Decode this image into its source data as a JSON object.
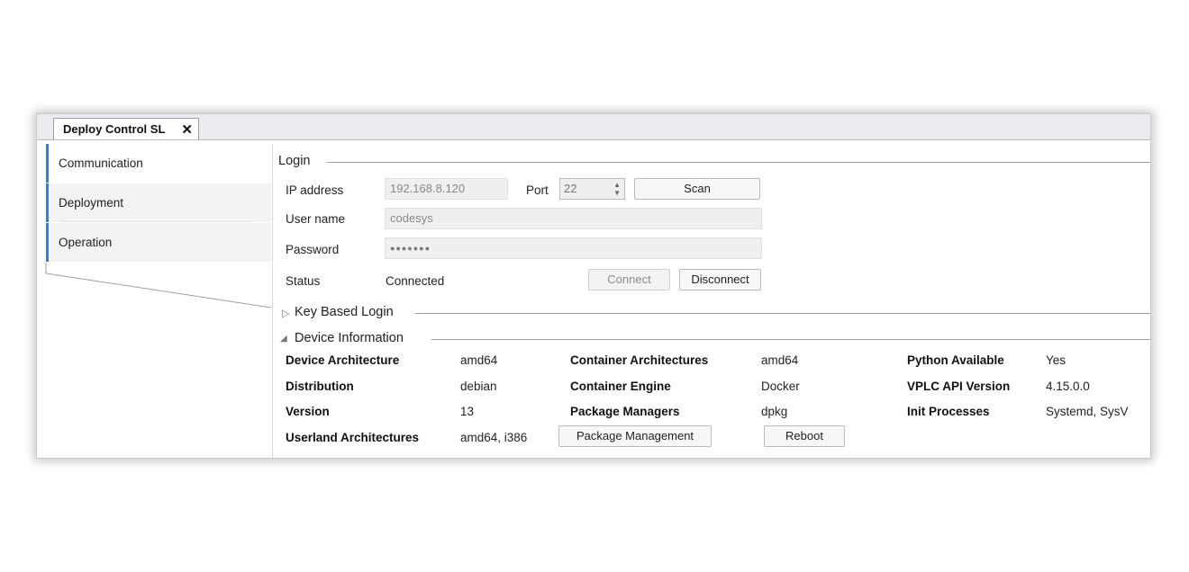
{
  "document_tab": {
    "title": "Deploy Control SL",
    "close_glyph": "✕"
  },
  "sidebar": {
    "items": [
      {
        "label": "Communication",
        "active": true
      },
      {
        "label": "Deployment",
        "active": false
      },
      {
        "label": "Operation",
        "active": false
      }
    ]
  },
  "login": {
    "title": "Login",
    "ip_label": "IP address",
    "ip_value": "192.168.8.120",
    "port_label": "Port",
    "port_value": "22",
    "scan_label": "Scan",
    "user_label": "User name",
    "user_value": "codesys",
    "password_label": "Password",
    "password_value": "●●●●●●●",
    "status_label": "Status",
    "status_value": "Connected",
    "connect_label": "Connect",
    "disconnect_label": "Disconnect"
  },
  "key_login": {
    "title": "Key Based Login",
    "expanded": false,
    "icon": "collapsed-triangle-icon"
  },
  "device_info": {
    "title": "Device Information",
    "expanded": true,
    "icon": "expanded-triangle-icon",
    "rows": [
      [
        {
          "k": "Device Architecture",
          "v": "amd64"
        },
        {
          "k": "Container Architectures",
          "v": "amd64"
        },
        {
          "k": "Python Available",
          "v": "Yes"
        }
      ],
      [
        {
          "k": "Distribution",
          "v": "debian"
        },
        {
          "k": "Container Engine",
          "v": "Docker"
        },
        {
          "k": "VPLC API Version",
          "v": "4.15.0.0"
        }
      ],
      [
        {
          "k": "Version",
          "v": "13"
        },
        {
          "k": "Package Managers",
          "v": "dpkg"
        },
        {
          "k": "Init Processes",
          "v": "Systemd, SysV"
        }
      ]
    ],
    "userland_label": "Userland Architectures",
    "userland_value": "amd64, i386",
    "package_mgmt_label": "Package Management",
    "reboot_label": "Reboot"
  }
}
